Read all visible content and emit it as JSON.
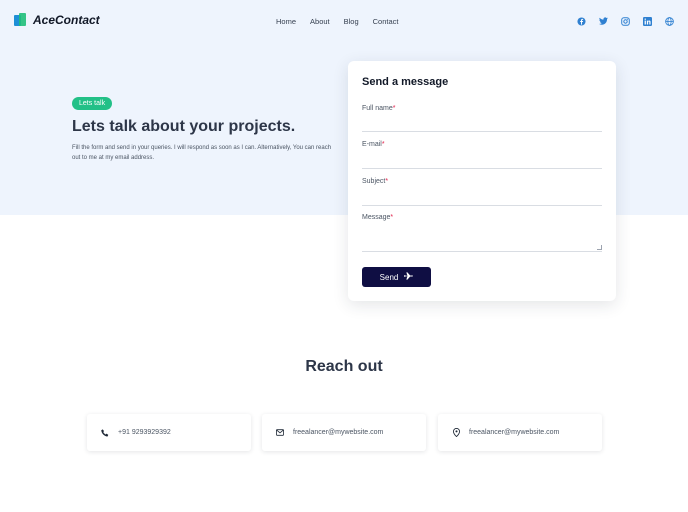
{
  "brand": {
    "name": "AceContact"
  },
  "nav": [
    "Home",
    "About",
    "Blog",
    "Contact"
  ],
  "social_icons": [
    "facebook-icon",
    "twitter-icon",
    "instagram-icon",
    "linkedin-icon",
    "globe-icon"
  ],
  "colors": {
    "accent_green": "#22c087",
    "brand_blue": "#1d8fd6",
    "button_navy": "#0f0e43",
    "hero_bg": "#eef4fd",
    "social_blue": "#2f80d1"
  },
  "hero": {
    "badge": "Lets talk",
    "title": "Lets talk about your projects.",
    "description": "Fill the form and send in your queries. I will respond as soon as I can. Alternatively, You can reach out to me at my email address."
  },
  "form": {
    "title": "Send a message",
    "fields": [
      {
        "label": "Full name",
        "required": "*",
        "value": ""
      },
      {
        "label": "E-mail",
        "required": "*",
        "value": ""
      },
      {
        "label": "Subject",
        "required": "*",
        "value": ""
      },
      {
        "label": "Message",
        "required": "*",
        "value": ""
      }
    ],
    "submit_label": "Send"
  },
  "reach": {
    "title": "Reach out",
    "items": [
      {
        "icon": "phone-icon",
        "text": "+91 9293929392"
      },
      {
        "icon": "mail-icon",
        "text": "freealancer@mywebsite.com"
      },
      {
        "icon": "location-pin-icon",
        "text": "freealancer@mywebsite.com"
      }
    ]
  }
}
